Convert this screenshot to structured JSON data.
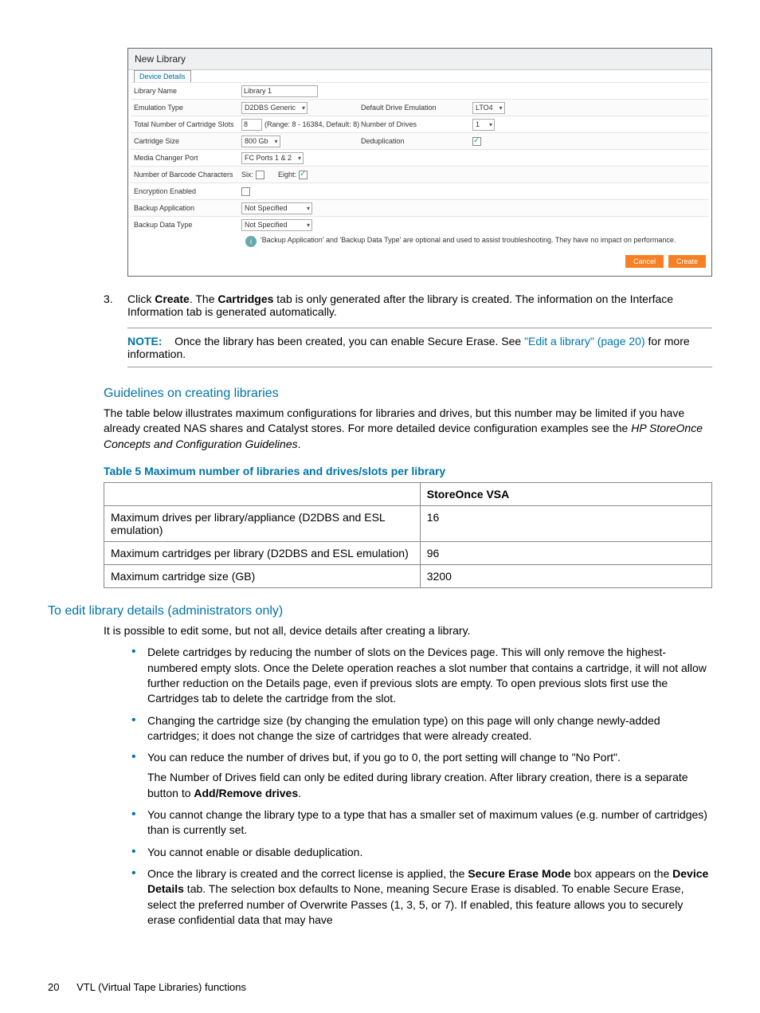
{
  "screenshot": {
    "title": "New Library",
    "tab": "Device Details",
    "rows": {
      "libName": {
        "label": "Library Name",
        "value": "Library 1"
      },
      "emu": {
        "label": "Emulation Type",
        "value": "D2DBS Generic",
        "label2": "Default Drive Emulation",
        "value2": "LTO4"
      },
      "slots": {
        "label": "Total Number of Cartridge Slots",
        "value": "8",
        "hint": "(Range: 8 - 16384, Default: 8)",
        "label2": "Number of Drives",
        "value2": "1"
      },
      "cart": {
        "label": "Cartridge Size",
        "value": "800 Gb",
        "label2": "Deduplication"
      },
      "mcp": {
        "label": "Media Changer Port",
        "value": "FC Ports 1 & 2"
      },
      "barcode": {
        "label": "Number of Barcode Characters",
        "six": "Six:",
        "eight": "Eight:"
      },
      "enc": {
        "label": "Encryption Enabled"
      },
      "bapp": {
        "label": "Backup Application",
        "value": "Not Specified"
      },
      "bdt": {
        "label": "Backup Data Type",
        "value": "Not Specified"
      },
      "info": "'Backup Application' and 'Backup Data Type' are optional and used to assist troubleshooting. They have no impact on performance."
    },
    "buttons": {
      "cancel": "Cancel",
      "create": "Create"
    }
  },
  "step3": {
    "num": "3.",
    "text_a": "Click ",
    "b1": "Create",
    "text_b": ". The ",
    "b2": "Cartridges",
    "text_c": " tab is only generated after the library is created. The information on the Interface Information tab is generated automatically."
  },
  "note": {
    "label": "NOTE:",
    "text_a": "Once the library has been created, you can enable Secure Erase. See ",
    "link": "\"Edit a library\" (page 20)",
    "text_b": " for more information."
  },
  "guidelines": {
    "heading": "Guidelines on creating libraries",
    "p1_a": "The table below illustrates maximum configurations for libraries and drives, but this number may be limited if you have already created NAS shares and Catalyst stores. For more detailed device configuration examples see the ",
    "p1_i": "HP StoreOnce Concepts and Configuration Guidelines",
    "p1_b": "."
  },
  "table5": {
    "caption": "Table 5 Maximum number of libraries and drives/slots per library",
    "header": {
      "c1": "",
      "c2": "StoreOnce VSA"
    },
    "rows": [
      {
        "c1": "Maximum drives per library/appliance (D2DBS and ESL emulation)",
        "c2": "16"
      },
      {
        "c1": "Maximum cartridges per library (D2DBS and ESL emulation)",
        "c2": "96"
      },
      {
        "c1": "Maximum cartridge size (GB)",
        "c2": "3200"
      }
    ]
  },
  "editSection": {
    "heading": "To edit library details (administrators only)",
    "intro": "It is possible to edit some, but not all, device details after creating a library.",
    "bullets": [
      {
        "t": "Delete cartridges by reducing the number of slots on the Devices page. This will only remove the highest-numbered empty slots. Once the Delete operation reaches a slot number that contains a cartridge, it will not allow further reduction on the Details page, even if previous slots are empty. To open previous slots first use the Cartridges tab to delete the cartridge from the slot."
      },
      {
        "t": "Changing the cartridge size (by changing the emulation type) on this page will only change newly-added cartridges; it does not change the size of cartridges that were already created."
      },
      {
        "t": "You can reduce the number of drives but, if you go to 0, the port setting will change to \"No Port\".",
        "extra_a": "The Number of Drives field can only be edited during library creation. After library creation, there is a separate button to ",
        "extra_b": "Add/Remove drives",
        "extra_c": "."
      },
      {
        "t": "You cannot change the library type to a type that has a smaller set of maximum values (e.g. number of cartridges) than is currently set."
      },
      {
        "t": "You cannot enable or disable deduplication."
      },
      {
        "t_a": "Once the library is created and the correct license is applied, the ",
        "b1": "Secure Erase Mode",
        "t_b": " box appears on the ",
        "b2": "Device Details",
        "t_c": " tab. The selection box defaults to None, meaning Secure Erase is disabled. To enable Secure Erase, select the preferred number of Overwrite Passes (1, 3, 5, or 7). If enabled, this feature allows you to securely erase confidential data that may have"
      }
    ]
  },
  "footer": {
    "page": "20",
    "title": "VTL (Virtual Tape Libraries) functions"
  }
}
